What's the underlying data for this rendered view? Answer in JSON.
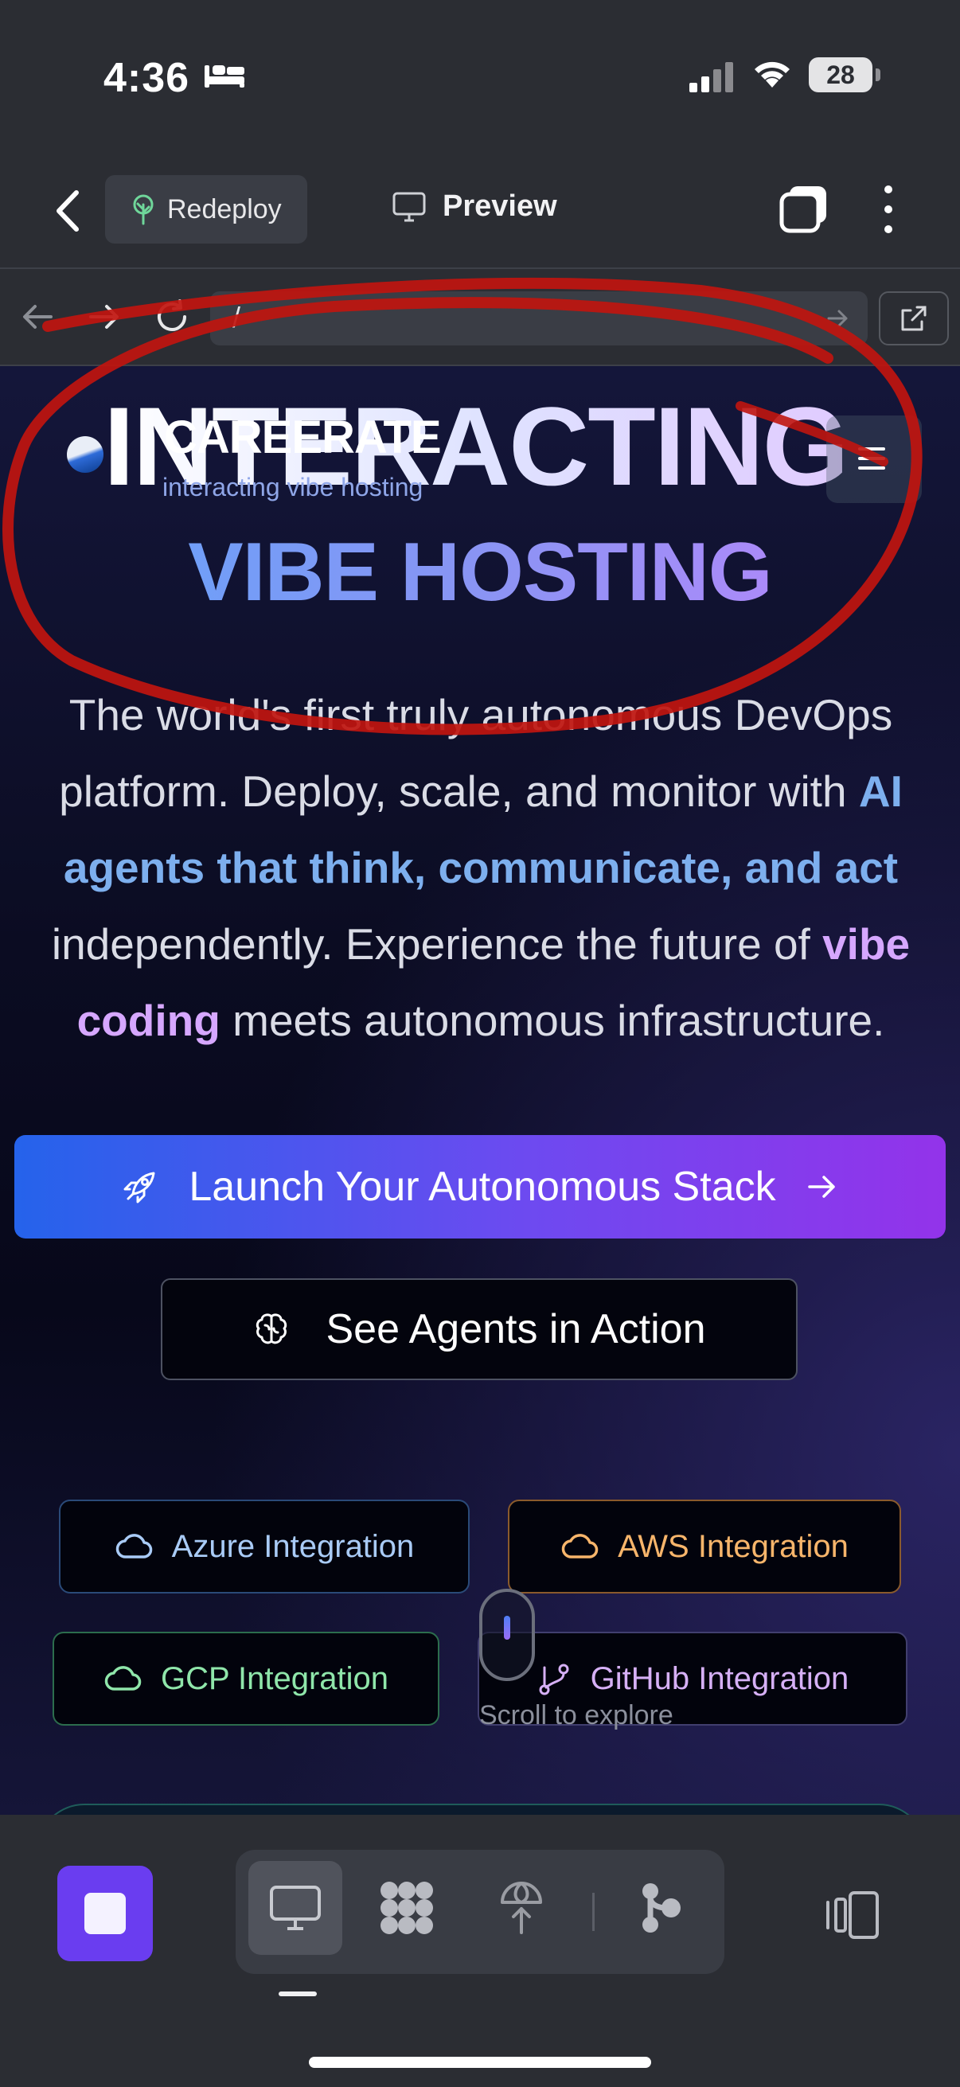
{
  "status_bar": {
    "time": "4:36",
    "battery": "28",
    "icons": [
      "bed-icon",
      "signal-icon",
      "wifi-icon",
      "battery-icon"
    ]
  },
  "app_bar": {
    "redeploy_label": "Redeploy",
    "preview_label": "Preview",
    "icons": [
      "back-chevron-icon",
      "sprout-icon",
      "monitor-icon",
      "tabs-icon",
      "more-vertical-icon"
    ]
  },
  "browser": {
    "url": "/",
    "icons": [
      "arrow-left-icon",
      "arrow-right-icon",
      "reload-icon",
      "go-arrow-icon",
      "external-link-icon"
    ]
  },
  "site": {
    "brand_name": "CAREERATE",
    "brand_tagline": "interacting vibe hosting",
    "hero_line1": "INTERACTING",
    "hero_line2": "VIBE HOSTING",
    "description": {
      "part1": "The world's first truly autonomous DevOps platform. Deploy, scale, and monitor with ",
      "highlight1": "AI agents that think, communicate, and act",
      "part2": " independently. Experience the future of ",
      "highlight2": "vibe coding",
      "part3": " meets autonomous infrastructure."
    },
    "cta_primary": "Launch Your Autonomous Stack",
    "cta_secondary": "See Agents in Action",
    "integrations": {
      "azure": "Azure Integration",
      "aws": "AWS Integration",
      "gcp": "GCP Integration",
      "github": "GitHub Integration"
    },
    "scroll_hint": "Scroll to explore"
  },
  "colors": {
    "accent_purple": "#6a3df0",
    "gradient_blue": "#2563eb",
    "gradient_purple": "#9333ea",
    "annotation_red": "#c0150f"
  },
  "toolbar": {
    "icons": [
      "stop-icon",
      "monitor-icon",
      "integrations-grid-icon",
      "deploy-icon",
      "git-branch-icon",
      "layout-toggle-icon"
    ]
  }
}
